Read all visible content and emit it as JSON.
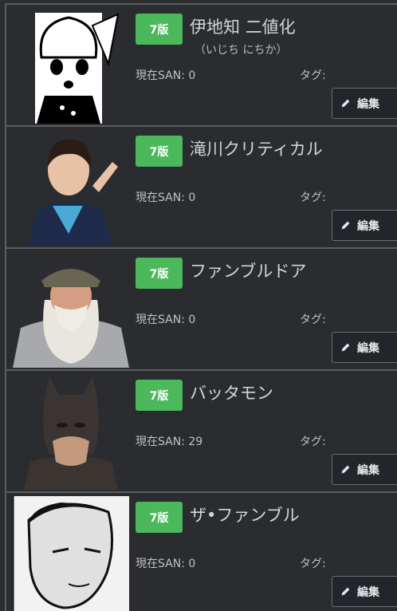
{
  "cards": [
    {
      "badge": "7版",
      "name": "伊地知 二値化",
      "furigana": "（いじち にちか）",
      "san": "現在SAN: 0",
      "tag": "タグ:",
      "edit": "編集",
      "portrait": "manga-girl-portrait"
    },
    {
      "badge": "7版",
      "name": "滝川クリティカル",
      "furigana": "",
      "san": "現在SAN: 0",
      "tag": "タグ:",
      "edit": "編集",
      "portrait": "woman-blue-scarf-portrait"
    },
    {
      "badge": "7版",
      "name": "ファンブルドア",
      "furigana": "",
      "san": "現在SAN: 0",
      "tag": "タグ:",
      "edit": "編集",
      "portrait": "old-wizard-portrait"
    },
    {
      "badge": "7版",
      "name": "バッタモン",
      "furigana": "",
      "san": "現在SAN: 29",
      "tag": "タグ:",
      "edit": "編集",
      "portrait": "masked-hero-portrait"
    },
    {
      "badge": "7版",
      "name": "ザ•ファンブル",
      "furigana": "",
      "san": "現在SAN: 0",
      "tag": "タグ:",
      "edit": "編集",
      "portrait": "manga-man-portrait"
    }
  ],
  "colors": {
    "badge": "#4cb85c",
    "background": "#2b2d31",
    "border": "#5a5d63"
  },
  "icons": {
    "edit": "pencil-icon"
  }
}
